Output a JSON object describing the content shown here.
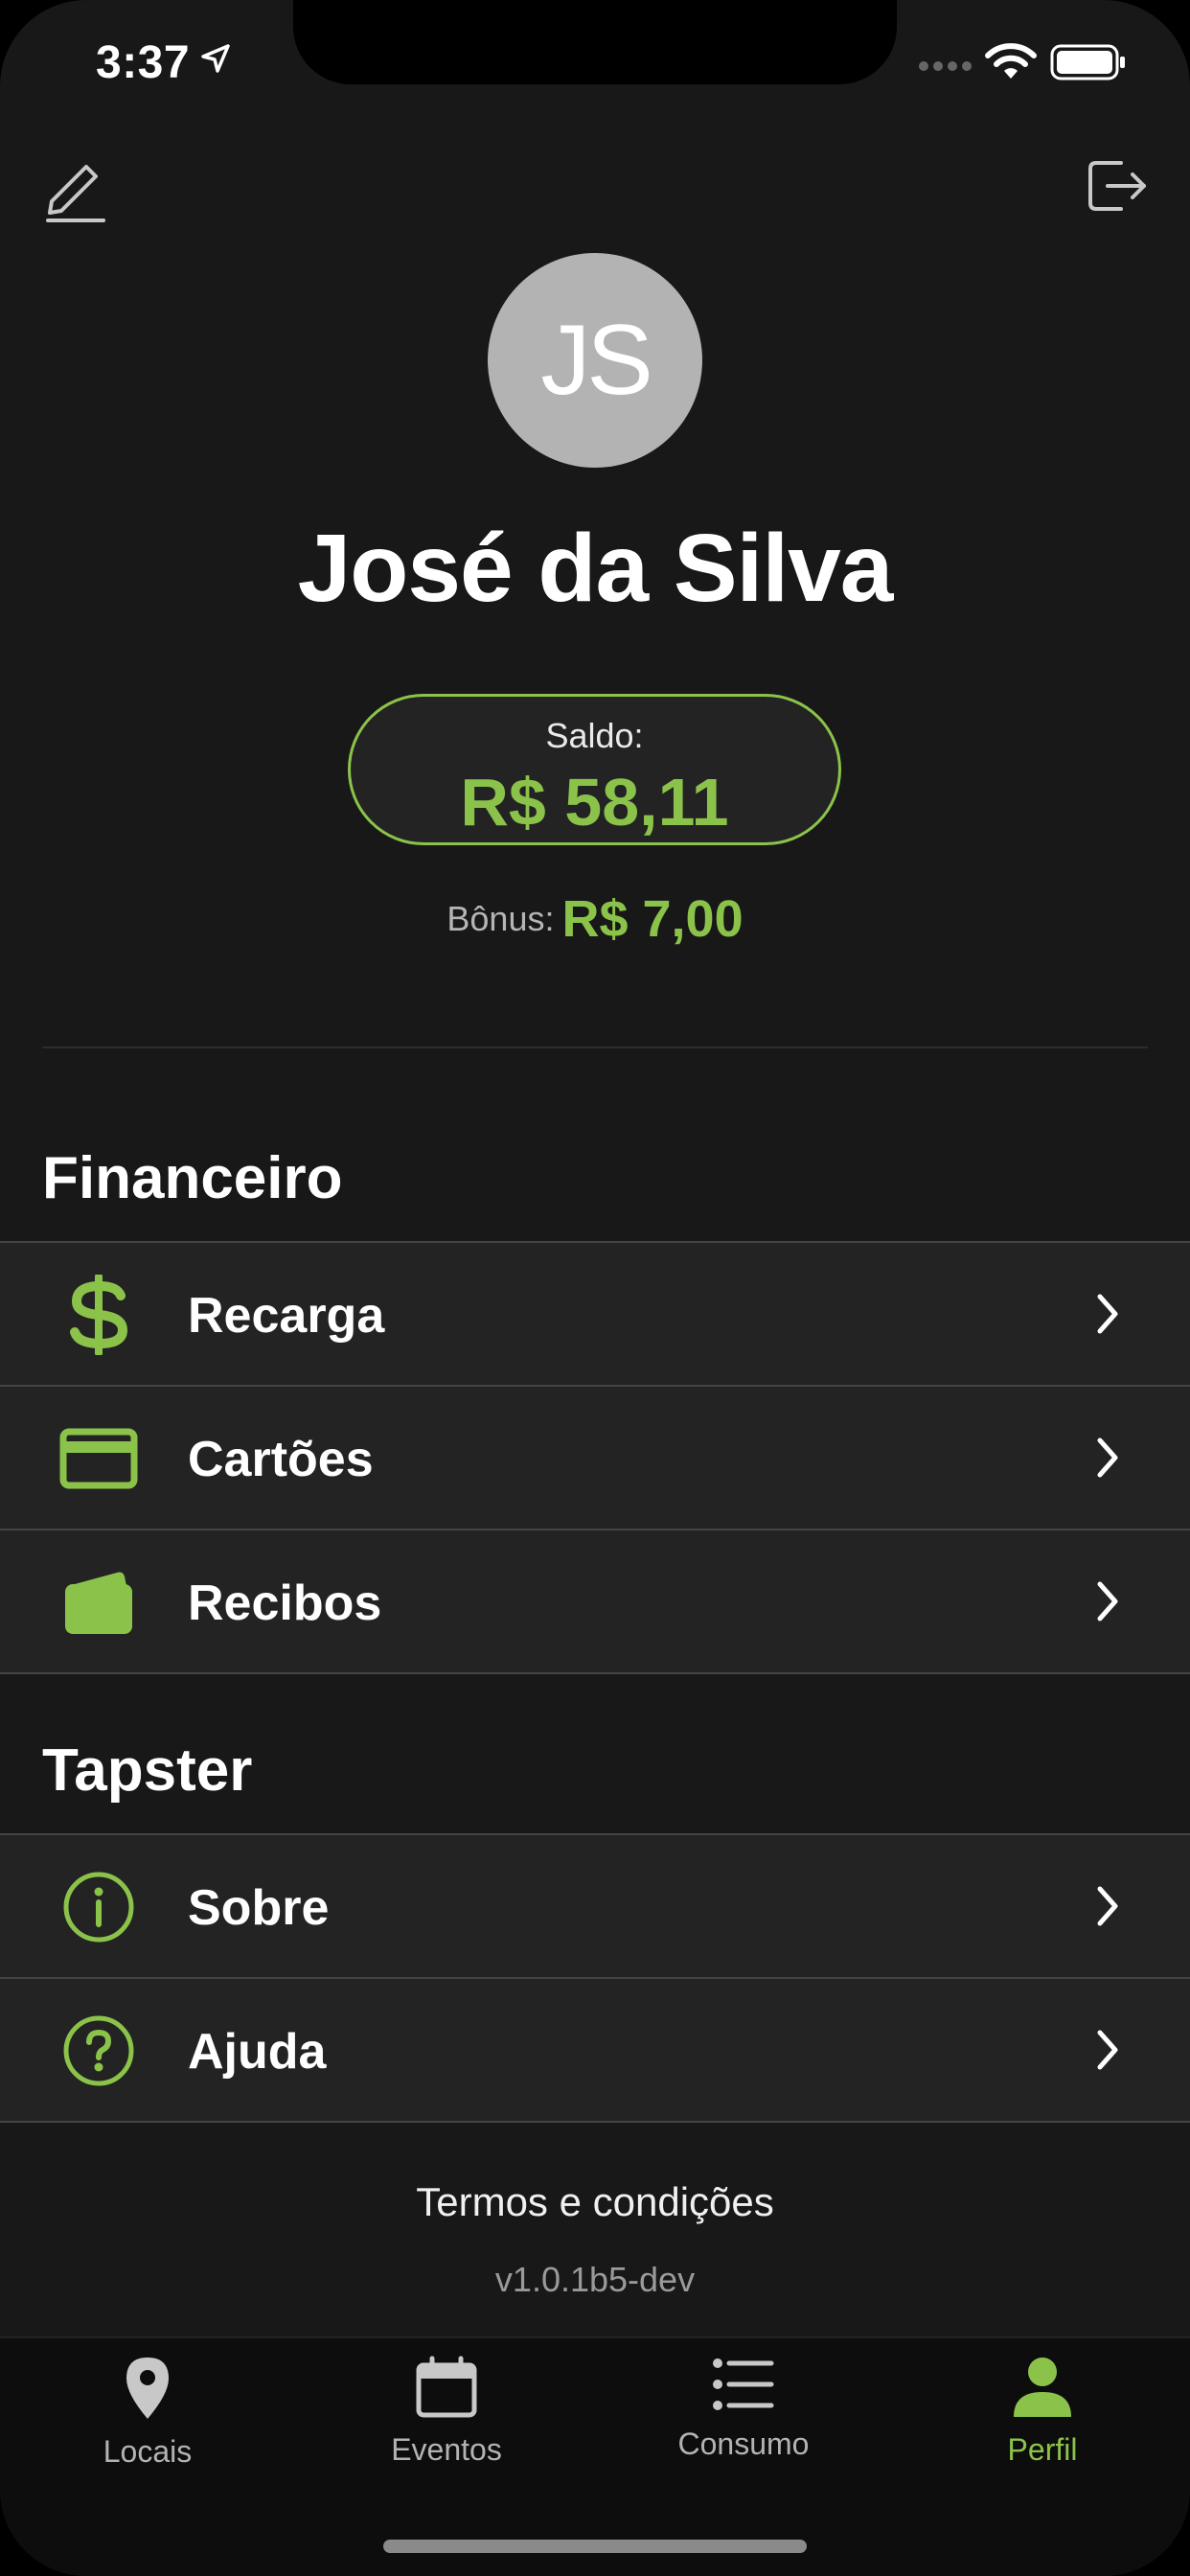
{
  "status_bar": {
    "time": "3:37"
  },
  "profile": {
    "initials": "JS",
    "name": "José da Silva",
    "balance_label": "Saldo:",
    "balance_value": "R$ 58,11",
    "bonus_label": "Bônus:",
    "bonus_value": "R$ 7,00"
  },
  "sections": {
    "financeiro": {
      "title": "Financeiro",
      "items": [
        {
          "label": "Recarga",
          "icon": "dollar-icon"
        },
        {
          "label": "Cartões",
          "icon": "credit-card-icon"
        },
        {
          "label": "Recibos",
          "icon": "wallet-icon"
        }
      ]
    },
    "tapster": {
      "title": "Tapster",
      "items": [
        {
          "label": "Sobre",
          "icon": "info-icon"
        },
        {
          "label": "Ajuda",
          "icon": "help-icon"
        }
      ]
    }
  },
  "footer": {
    "terms": "Termos e condições",
    "version": "v1.0.1b5-dev"
  },
  "tabbar": {
    "tabs": [
      {
        "label": "Locais",
        "icon": "location-pin-icon"
      },
      {
        "label": "Eventos",
        "icon": "calendar-icon"
      },
      {
        "label": "Consumo",
        "icon": "list-icon"
      },
      {
        "label": "Perfil",
        "icon": "person-icon",
        "active": true
      }
    ]
  },
  "colors": {
    "accent": "#8bc34a",
    "background": "#181818",
    "row_background": "#232323"
  }
}
